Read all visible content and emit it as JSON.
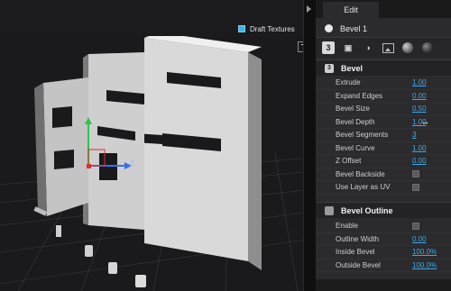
{
  "viewport": {
    "draft_textures_label": "Draft Textures",
    "draft_textures_checked": true,
    "axis_label_z": "Z"
  },
  "panel": {
    "tab_label": "Edit",
    "object_name": "Bevel 1",
    "toolbar_icons": [
      "bevel-tool-icon",
      "extrude-tool-icon",
      "material-blend-icon",
      "image-icon",
      "sphere-material-icon",
      "environment-sphere-icon"
    ],
    "bevel": {
      "title": "Bevel",
      "section_icon_glyph": "3",
      "properties": [
        {
          "label": "Extrude",
          "value": "1.00"
        },
        {
          "label": "Expand Edges",
          "value": "0.00"
        },
        {
          "label": "Bevel Size",
          "value": "0.50"
        },
        {
          "label": "Bevel Depth",
          "value": "1.00"
        },
        {
          "label": "Bevel Segments",
          "value": "3"
        },
        {
          "label": "Bevel Curve",
          "value": "1.00"
        },
        {
          "label": "Z Offset",
          "value": "0.00"
        },
        {
          "label": "Bevel Backside",
          "value": ""
        },
        {
          "label": "Use Layer as UV",
          "value": ""
        }
      ]
    },
    "outline": {
      "title": "Bevel Outline",
      "properties": [
        {
          "label": "Enable",
          "value": ""
        },
        {
          "label": "Outline Width",
          "value": "0.00"
        },
        {
          "label": "Inside Bevel",
          "value": "100.0%"
        },
        {
          "label": "Outside Bevel",
          "value": "100.0%"
        }
      ]
    }
  },
  "colors": {
    "accent": "#3fa8e6",
    "panel_bg": "#2b2b2e",
    "viewport_bg": "#1a1a1c",
    "axis_x": "#d93030",
    "axis_y": "#2fc44a",
    "axis_z": "#3a6ef0"
  }
}
